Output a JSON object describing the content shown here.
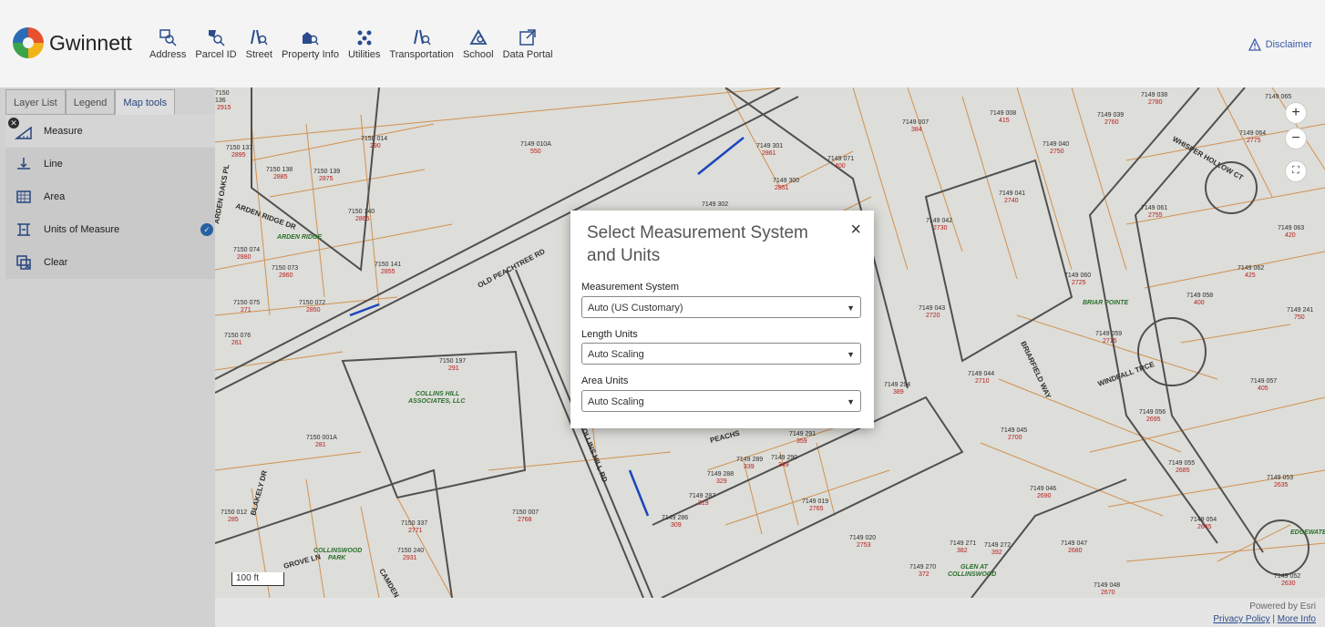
{
  "app": {
    "title": "Gwinnett"
  },
  "nav": [
    {
      "label": "Address",
      "icon": "address-search-icon"
    },
    {
      "label": "Parcel ID",
      "icon": "parcel-search-icon"
    },
    {
      "label": "Street",
      "icon": "street-search-icon"
    },
    {
      "label": "Property Info",
      "icon": "property-search-icon"
    },
    {
      "label": "Utilities",
      "icon": "utilities-icon"
    },
    {
      "label": "Transportation",
      "icon": "transportation-icon"
    },
    {
      "label": "School",
      "icon": "school-icon"
    },
    {
      "label": "Data Portal",
      "icon": "external-link-icon"
    }
  ],
  "header": {
    "disclaimer": "Disclaimer"
  },
  "panel": {
    "tabs": [
      "Layer List",
      "Legend",
      "Map tools"
    ],
    "active_tab": "Map tools",
    "tools": [
      {
        "label": "Measure"
      },
      {
        "label": "Line"
      },
      {
        "label": "Area"
      },
      {
        "label": "Units of Measure"
      },
      {
        "label": "Clear"
      }
    ]
  },
  "map": {
    "scale": "100 ft",
    "powered_by": "Powered by Esri",
    "privacy": "Privacy Policy",
    "more_info": "More Info",
    "zoom_in": "+",
    "zoom_out": "−",
    "streets": [
      "OLD PEACHTREE RD",
      "ARDEN RIDGE DR",
      "ARDEN OAKS PL",
      "BLAKELY DR",
      "WHISPER HOLLOW CT",
      "BRIARFIELD WAY",
      "WINDFALL TRCE",
      "COLLINS HILL RD",
      "PEACHS",
      "CAMDEN DR",
      "GROVE LN"
    ],
    "areas": [
      "ARDEN RIDGE",
      "COLLINS HILL ASSOCIATES, LLC",
      "BRIAR POINTE",
      "COLLINSWOOD PARK",
      "GLEN AT COLLINSWOOD",
      "EDGEWATER"
    ],
    "parcels": [
      {
        "id": "7150 137",
        "num": "2895"
      },
      {
        "id": "7150 138",
        "num": "2885"
      },
      {
        "id": "7150 139",
        "num": "2875"
      },
      {
        "id": "7150 014",
        "num": "290"
      },
      {
        "id": "7149 010A",
        "num": "550"
      },
      {
        "id": "7150 140",
        "num": "2865"
      },
      {
        "id": "7150 074",
        "num": "2880"
      },
      {
        "id": "7150 073",
        "num": "2860"
      },
      {
        "id": "7150 141",
        "num": "2855"
      },
      {
        "id": "7150 075",
        "num": "271"
      },
      {
        "id": "7150 072",
        "num": "2850"
      },
      {
        "id": "7150 076",
        "num": "261"
      },
      {
        "id": "7150 197",
        "num": "291"
      },
      {
        "id": "7150 001A",
        "num": "281"
      },
      {
        "id": "7150 007",
        "num": "2768"
      },
      {
        "id": "7150 012",
        "num": "285"
      },
      {
        "id": "7150 337",
        "num": "2771"
      },
      {
        "id": "7150 240",
        "num": "2931"
      },
      {
        "id": "7149 301",
        "num": "2861"
      },
      {
        "id": "7149 300",
        "num": "2851"
      },
      {
        "id": "7149 302",
        "num": ""
      },
      {
        "id": "7149 071",
        "num": "400"
      },
      {
        "id": "7149 007",
        "num": "384"
      },
      {
        "id": "7149 008",
        "num": "415"
      },
      {
        "id": "7149 039",
        "num": "2760"
      },
      {
        "id": "7149 038",
        "num": "2780"
      },
      {
        "id": "7149 065",
        "num": "2785"
      },
      {
        "id": "7149 064",
        "num": "2775"
      },
      {
        "id": "7149 040",
        "num": "2750"
      },
      {
        "id": "7149 041",
        "num": "2740"
      },
      {
        "id": "7149 042",
        "num": "2730"
      },
      {
        "id": "7149 061",
        "num": "2755"
      },
      {
        "id": "7149 063",
        "num": "420"
      },
      {
        "id": "7149 060",
        "num": "2725"
      },
      {
        "id": "7149 062",
        "num": "425"
      },
      {
        "id": "7149 058",
        "num": "400"
      },
      {
        "id": "7149 043",
        "num": "2720"
      },
      {
        "id": "7149 059",
        "num": "2715"
      },
      {
        "id": "7149 241",
        "num": "750"
      },
      {
        "id": "7149 044",
        "num": "2710"
      },
      {
        "id": "7149 294",
        "num": "389"
      },
      {
        "id": "7149 057",
        "num": "405"
      },
      {
        "id": "7149 056",
        "num": "2695"
      },
      {
        "id": "7149 045",
        "num": "2700"
      },
      {
        "id": "7149 291",
        "num": "359"
      },
      {
        "id": "7149 290",
        "num": "349"
      },
      {
        "id": "7149 289",
        "num": "339"
      },
      {
        "id": "7149 288",
        "num": "329"
      },
      {
        "id": "7149 287",
        "num": "319"
      },
      {
        "id": "7149 286",
        "num": "309"
      },
      {
        "id": "7149 019",
        "num": "2765"
      },
      {
        "id": "7149 055",
        "num": "2685"
      },
      {
        "id": "7149 053",
        "num": "2635"
      },
      {
        "id": "7149 046",
        "num": "2690"
      },
      {
        "id": "7149 054",
        "num": "2645"
      },
      {
        "id": "7149 020",
        "num": "2753"
      },
      {
        "id": "7149 271",
        "num": "382"
      },
      {
        "id": "7149 272",
        "num": "392"
      },
      {
        "id": "7149 047",
        "num": "2680"
      },
      {
        "id": "7149 270",
        "num": "372"
      },
      {
        "id": "7149 048",
        "num": "2670"
      },
      {
        "id": "7149 052",
        "num": "2630"
      }
    ]
  },
  "dialog": {
    "title": "Select Measurement System and Units",
    "close": "×",
    "fields": [
      {
        "label": "Measurement System",
        "value": "Auto (US Customary)"
      },
      {
        "label": "Length Units",
        "value": "Auto Scaling"
      },
      {
        "label": "Area Units",
        "value": "Auto Scaling"
      }
    ]
  },
  "colors": {
    "accent": "#2b4c8c",
    "parcel_line": "#e8a35a",
    "road_line": "#555555",
    "highlight": "#1f4fd1",
    "label_red": "#cc2222"
  }
}
